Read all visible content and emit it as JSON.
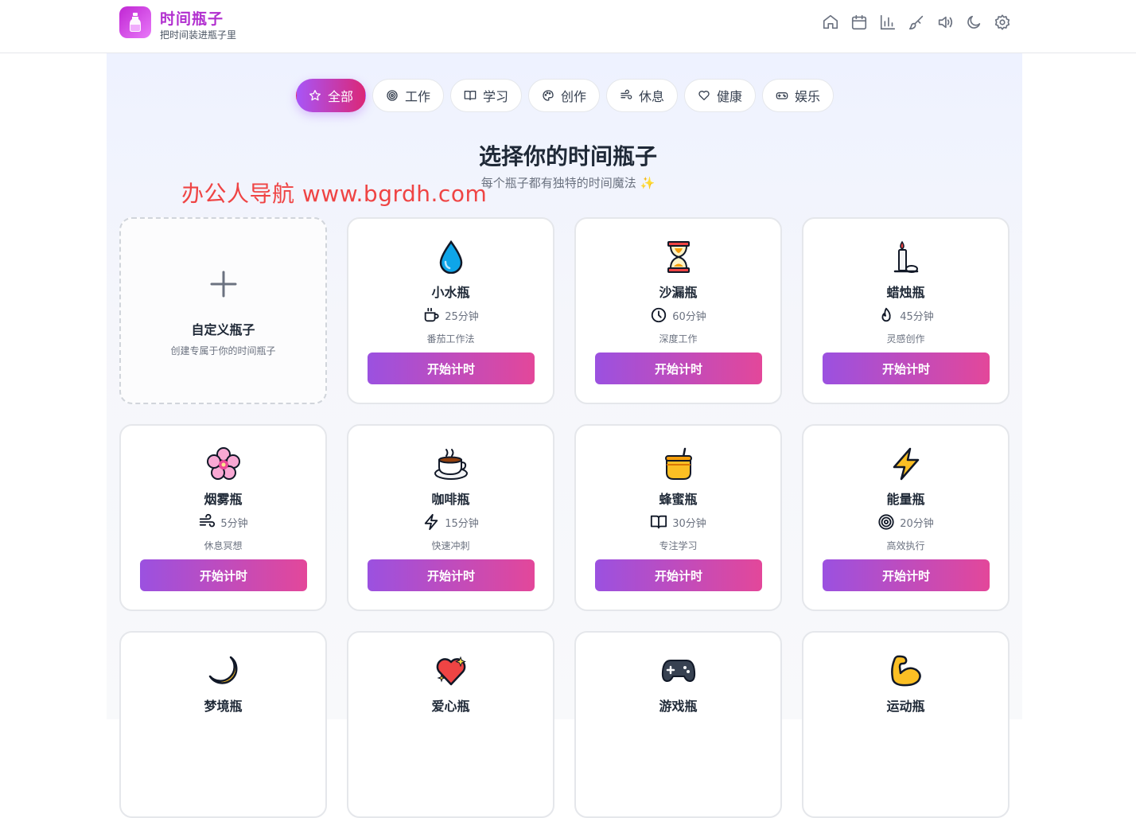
{
  "header": {
    "title": "时间瓶子",
    "subtitle": "把时间装进瓶子里",
    "icons": [
      "home-icon",
      "calendar-icon",
      "chart-icon",
      "brush-icon",
      "volume-icon",
      "moon-icon",
      "settings-icon"
    ]
  },
  "categories": [
    {
      "label": "全部",
      "icon": "star-icon",
      "active": true
    },
    {
      "label": "工作",
      "icon": "target-icon"
    },
    {
      "label": "学习",
      "icon": "book-icon"
    },
    {
      "label": "创作",
      "icon": "palette-icon"
    },
    {
      "label": "休息",
      "icon": "wind-icon"
    },
    {
      "label": "健康",
      "icon": "heart-icon"
    },
    {
      "label": "娱乐",
      "icon": "gamepad-icon"
    }
  ],
  "headline": "选择你的时间瓶子",
  "subline": "每个瓶子都有独特的时间魔法 ✨",
  "watermark": "办公人导航  www.bgrdh.com",
  "custom_card": {
    "title": "自定义瓶子",
    "desc": "创建专属于你的时间瓶子"
  },
  "start_label": "开始计时",
  "bottles": [
    {
      "name": "小水瓶",
      "duration": "25分钟",
      "desc": "番茄工作法",
      "emoji": "💧",
      "meta_icon": "cup-icon"
    },
    {
      "name": "沙漏瓶",
      "duration": "60分钟",
      "desc": "深度工作",
      "emoji": "⏳",
      "meta_icon": "clock-icon"
    },
    {
      "name": "蜡烛瓶",
      "duration": "45分钟",
      "desc": "灵感创作",
      "emoji": "🕯️",
      "meta_icon": "flame-icon"
    },
    {
      "name": "烟雾瓶",
      "duration": "5分钟",
      "desc": "休息冥想",
      "emoji": "🌸",
      "meta_icon": "wind-icon"
    },
    {
      "name": "咖啡瓶",
      "duration": "15分钟",
      "desc": "快速冲刺",
      "emoji": "☕",
      "meta_icon": "bolt-icon"
    },
    {
      "name": "蜂蜜瓶",
      "duration": "30分钟",
      "desc": "专注学习",
      "emoji": "🍯",
      "meta_icon": "book-icon"
    },
    {
      "name": "能量瓶",
      "duration": "20分钟",
      "desc": "高效执行",
      "emoji": "⚡",
      "meta_icon": "target-icon"
    },
    {
      "name": "梦境瓶",
      "emoji": "🌙"
    },
    {
      "name": "爱心瓶",
      "emoji": "💖"
    },
    {
      "name": "游戏瓶",
      "emoji": "🎮"
    },
    {
      "name": "运动瓶",
      "emoji": "💪"
    }
  ],
  "colors": {
    "accent_start": "#9b51e0",
    "accent_end": "#e3479a",
    "title": "#b12ecf"
  }
}
